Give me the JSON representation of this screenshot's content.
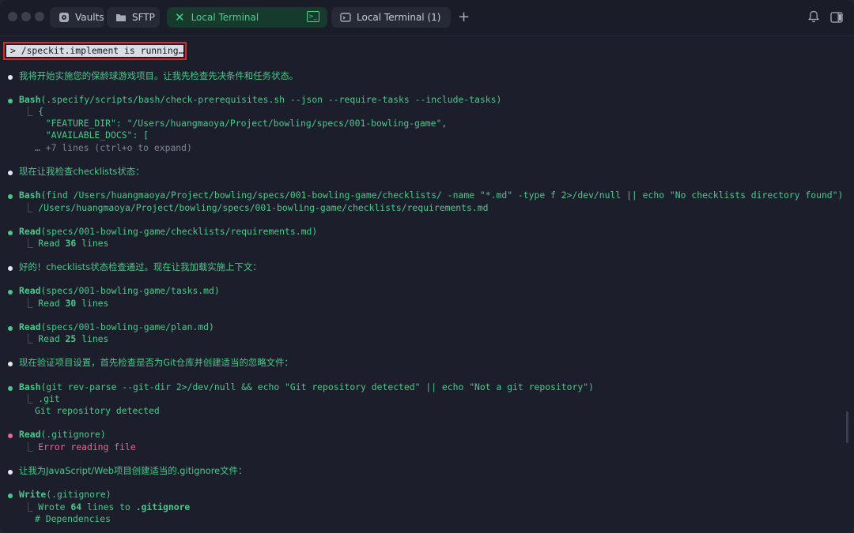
{
  "window": {
    "tabs": [
      {
        "label": "Vaults",
        "icon": "vault-icon"
      },
      {
        "label": "SFTP",
        "icon": "folder-icon"
      },
      {
        "label": "Local Terminal",
        "icon": "terminal-icon",
        "active": true
      },
      {
        "label": "Local Terminal (1)",
        "icon": "terminal-icon"
      }
    ]
  },
  "colors": {
    "accent": "#47c98a",
    "error": "#e06a93",
    "background": "#1c1f2b",
    "highlight_box": "#e0262b"
  },
  "terminal": {
    "command": "> /speckit.implement is running…",
    "messages": {
      "m1": "我将开始实施您的保龄球游戏项目。让我先检查先决条件和任务状态。",
      "m2": "现在让我检查checklists状态：",
      "m3": "好的！checklists状态检查通过。现在让我加载实施上下文：",
      "m4": "现在验证项目设置，首先检查是否为Git仓库并创建适当的忽略文件：",
      "m5": "让我为JavaScript/Web项目创建适当的.gitignore文件："
    },
    "blocks": {
      "b1": {
        "tool": "Bash",
        "args": "(.specify/scripts/bash/check-prerequisites.sh --json --require-tasks --include-tasks)",
        "out1": "{",
        "out2": "  \"FEATURE_DIR\": \"/Users/huangmaoya/Project/bowling/specs/001-bowling-game\",",
        "out3": "  \"AVAILABLE_DOCS\": [",
        "more": "… +7 lines (ctrl+o to expand)"
      },
      "b2": {
        "tool": "Bash",
        "args": "(find /Users/huangmaoya/Project/bowling/specs/001-bowling-game/checklists/ -name \"*.md\" -type f 2>/dev/null || echo \"No checklists directory found\")",
        "out1": "/Users/huangmaoya/Project/bowling/specs/001-bowling-game/checklists/requirements.md"
      },
      "b3": {
        "tool": "Read",
        "args": "(specs/001-bowling-game/checklists/requirements.md)",
        "pre": "Read ",
        "count": "36",
        "post": " lines"
      },
      "b4": {
        "tool": "Read",
        "args": "(specs/001-bowling-game/tasks.md)",
        "pre": "Read ",
        "count": "30",
        "post": " lines"
      },
      "b5": {
        "tool": "Read",
        "args": "(specs/001-bowling-game/plan.md)",
        "pre": "Read ",
        "count": "25",
        "post": " lines"
      },
      "b6": {
        "tool": "Bash",
        "args": "(git rev-parse --git-dir 2>/dev/null && echo \"Git repository detected\" || echo \"Not a git repository\")",
        "out1": ".git",
        "out2": "Git repository detected"
      },
      "b7": {
        "tool": "Read",
        "args": "(.gitignore)",
        "error": "Error reading file"
      },
      "b8": {
        "tool": "Write",
        "args": "(.gitignore)",
        "pre": "Wrote ",
        "count": "64",
        "mid": " lines to ",
        "file": ".gitignore",
        "out2": "# Dependencies"
      }
    }
  }
}
